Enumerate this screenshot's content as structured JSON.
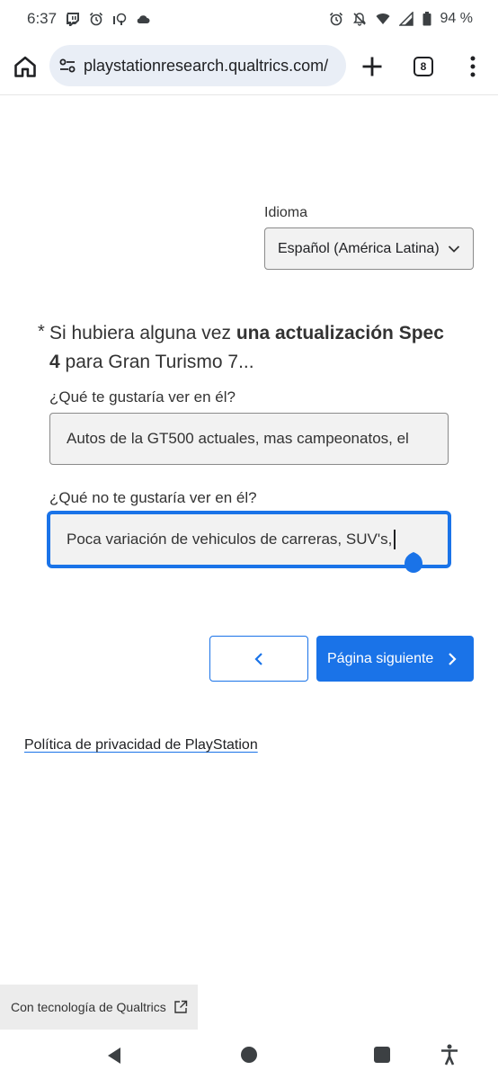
{
  "status_bar": {
    "time": "6:37",
    "battery": "94 %"
  },
  "browser": {
    "url": "playstationresearch.qualtrics.com/",
    "tab_count": "8"
  },
  "language": {
    "label": "Idioma",
    "selected": "Español (América Latina)"
  },
  "question": {
    "required_marker": "*",
    "text_part1": "Si hubiera alguna vez ",
    "text_bold1": "una actualización Spec 4",
    "text_part2": " para Gran Turismo 7..."
  },
  "fields": [
    {
      "label": "¿Qué te gustaría ver en él?",
      "value": "Autos de la GT500 actuales, mas campeonatos, el"
    },
    {
      "label": "¿Qué no te gustaría ver en él?",
      "value": "Poca variación de vehiculos de carreras, SUV's,"
    }
  ],
  "navigation": {
    "next_label": "Página siguiente"
  },
  "footer": {
    "privacy_link": "Política de privacidad de PlayStation",
    "powered_by": "Con tecnología de Qualtrics"
  },
  "colors": {
    "accent": "#1a73e8",
    "field_bg": "#f2f2f2",
    "url_pill": "#e9eef6"
  }
}
